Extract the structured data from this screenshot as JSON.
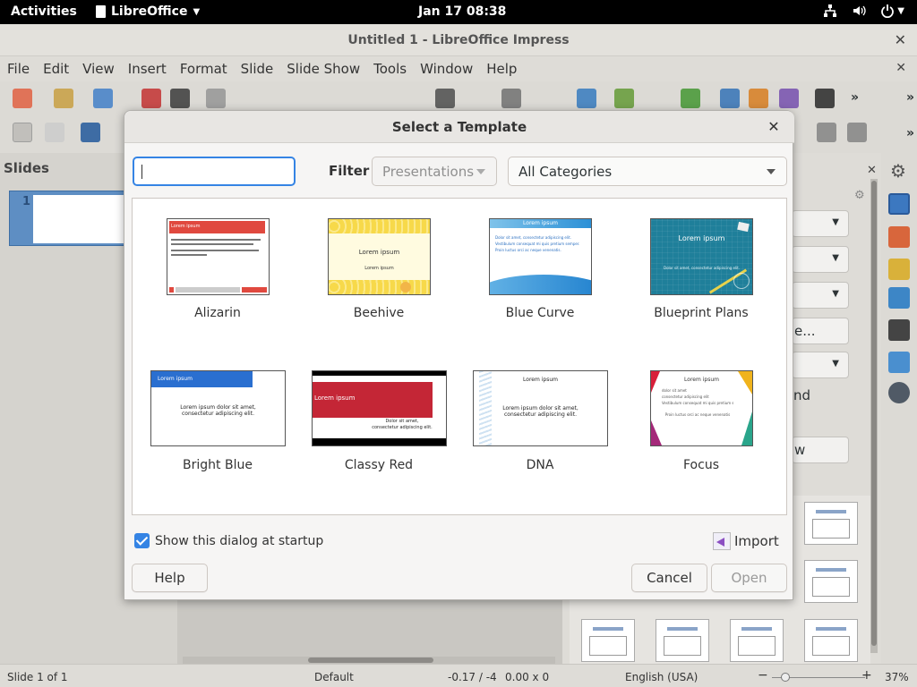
{
  "topbar": {
    "activities": "Activities",
    "app_name": "LibreOffice",
    "clock": "Jan 17  08:38"
  },
  "window": {
    "title": "Untitled 1 - LibreOffice Impress"
  },
  "menu": [
    "File",
    "Edit",
    "View",
    "Insert",
    "Format",
    "Slide",
    "Slide Show",
    "Tools",
    "Window",
    "Help"
  ],
  "slides_pane": {
    "label": "Slides",
    "slide_number": "1"
  },
  "sidebar": {
    "partial_text_1": "e...",
    "partial_text_2": "nd",
    "partial_text_3": "w"
  },
  "statusbar": {
    "slide_info": "Slide 1 of 1",
    "master": "Default",
    "position": "-0.17 / -4",
    "size": "0.00 x 0",
    "language": "English (USA)",
    "zoom": "37%"
  },
  "dialog": {
    "title": "Select a Template",
    "search_value": "",
    "filter_label": "Filter",
    "filter_value": "Presentations",
    "category_value": "All Categories",
    "templates": [
      {
        "name": "Alizarin"
      },
      {
        "name": "Beehive"
      },
      {
        "name": "Blue Curve"
      },
      {
        "name": "Blueprint Plans"
      },
      {
        "name": "Bright Blue"
      },
      {
        "name": "Classy Red"
      },
      {
        "name": "DNA"
      },
      {
        "name": "Focus"
      }
    ],
    "thumb_text": {
      "lorem": "Lorem ipsum",
      "lorem_long": "Lorem ipsum dolor sit amet,",
      "consectetur": "consectetur adipiscing elit.",
      "dolor": "Dolor sit amet,",
      "blue_curve_1": "Dolor sit amet, consectetur adipiscing elit.",
      "blue_curve_2": "Vestibulum consequat mi quis pretium semper.",
      "blue_curve_3": "Proin luctus orci ac neque venenatis.",
      "blueprint_sub": "Dolor sit amet, consectetur adipiscing elit.",
      "focus_1": "dolor sit amet",
      "focus_2": "consectetur adipiscing elit",
      "focus_3": "Vestibulum consequat mi quis pretium semper",
      "focus_4": "Proin luctus orci ac neque venenatis"
    },
    "show_at_startup_label": "Show this dialog at startup",
    "show_at_startup_checked": true,
    "import_label": "Import",
    "help_label": "Help",
    "cancel_label": "Cancel",
    "open_label": "Open"
  }
}
